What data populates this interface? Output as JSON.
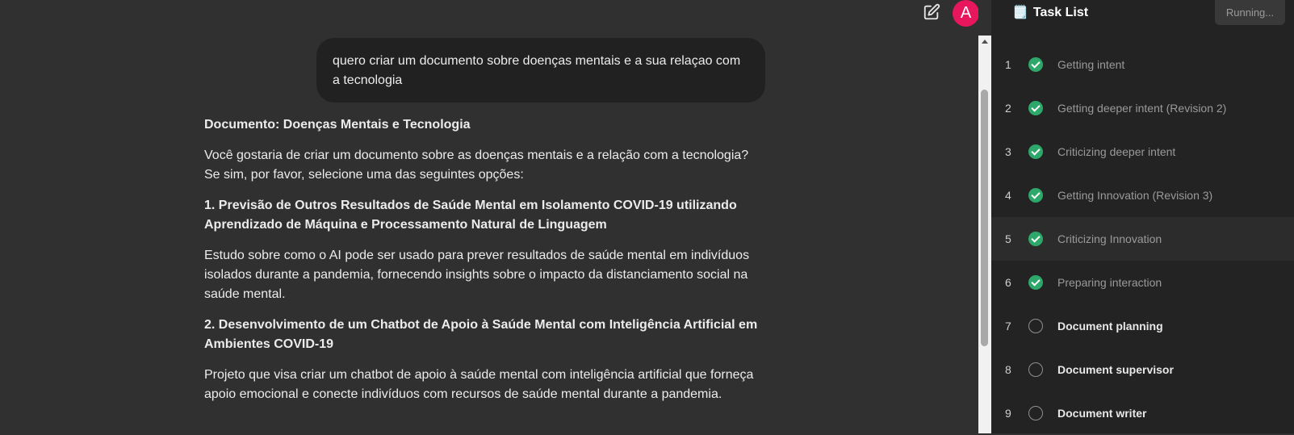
{
  "header": {
    "avatar_letter": "A"
  },
  "chat": {
    "user_message": "quero criar um documento sobre doenças mentais e a sua relaçao com a tecnologia",
    "answer": {
      "title": "Documento: Doenças Mentais e Tecnologia",
      "intro": "Você gostaria de criar um documento sobre as doenças mentais e a relação com a tecnologia? Se sim, por favor, selecione uma das seguintes opções:",
      "options": [
        {
          "title": "1. Previsão de Outros Resultados de Saúde Mental em Isolamento COVID-19 utilizando Aprendizado de Máquina e Processamento Natural de Linguagem",
          "description": "Estudo sobre como o AI pode ser usado para prever resultados de saúde mental em indivíduos isolados durante a pandemia, fornecendo insights sobre o impacto da distanciamento social na saúde mental."
        },
        {
          "title": "2. Desenvolvimento de um Chatbot de Apoio à Saúde Mental com Inteligência Artificial em Ambientes COVID-19",
          "description": "Projeto que visa criar um chatbot de apoio à saúde mental com inteligência artificial que forneça apoio emocional e conecte indivíduos com recursos de saúde mental durante a pandemia."
        }
      ]
    }
  },
  "task_panel": {
    "icon": "🗒️",
    "title": "Task List",
    "status_button": "Running...",
    "tasks": [
      {
        "number": "1",
        "label": "Getting intent",
        "status": "done"
      },
      {
        "number": "2",
        "label": "Getting deeper intent (Revision 2)",
        "status": "done"
      },
      {
        "number": "3",
        "label": "Criticizing deeper intent",
        "status": "done"
      },
      {
        "number": "4",
        "label": "Getting Innovation (Revision 3)",
        "status": "done"
      },
      {
        "number": "5",
        "label": "Criticizing Innovation",
        "status": "done"
      },
      {
        "number": "6",
        "label": "Preparing interaction",
        "status": "done"
      },
      {
        "number": "7",
        "label": "Document planning",
        "status": "pending"
      },
      {
        "number": "8",
        "label": "Document supervisor",
        "status": "pending"
      },
      {
        "number": "9",
        "label": "Document writer",
        "status": "pending"
      }
    ]
  },
  "colors": {
    "avatar": "#e8175d",
    "check": "#2ea86a",
    "chat_bg": "#303030",
    "panel_bg": "#232323"
  }
}
